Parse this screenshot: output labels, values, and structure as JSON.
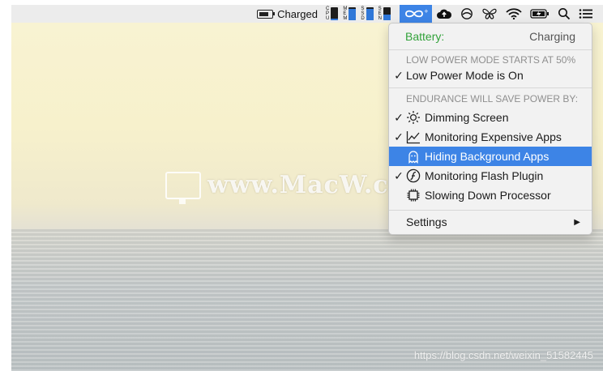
{
  "menubar": {
    "battery_text": "Charged",
    "stats": [
      {
        "letters": [
          "C",
          "P",
          "U"
        ],
        "fill": 0.15
      },
      {
        "letters": [
          "M",
          "E",
          "M"
        ],
        "fill": 0.85
      },
      {
        "letters": [
          "S",
          "S",
          "D"
        ],
        "fill": 0.9
      },
      {
        "letters": [
          "S",
          "E",
          "N"
        ],
        "fill": 0.45
      }
    ],
    "icons": [
      "endurance-icon",
      "cloud-upload-icon",
      "circle-slash-icon",
      "butterfly-icon",
      "wifi-icon",
      "battery-charging-icon",
      "search-icon",
      "list-icon"
    ]
  },
  "dropdown": {
    "battery_label": "Battery:",
    "battery_value": "Charging",
    "low_power_header": "LOW POWER MODE STARTS AT 50%",
    "low_power_item": "Low Power Mode is On",
    "endurance_header": "ENDURANCE WILL SAVE POWER BY:",
    "items": [
      {
        "label": "Dimming Screen",
        "checked": true,
        "icon": "sun-icon"
      },
      {
        "label": "Monitoring Expensive Apps",
        "checked": true,
        "icon": "chart-line-icon"
      },
      {
        "label": "Hiding Background Apps",
        "checked": false,
        "icon": "ghost-icon",
        "highlighted": true
      },
      {
        "label": "Monitoring Flash Plugin",
        "checked": true,
        "icon": "flash-plugin-icon"
      },
      {
        "label": "Slowing Down Processor",
        "checked": false,
        "icon": "processor-icon"
      }
    ],
    "settings_label": "Settings",
    "check_glyph": "✓",
    "submenu_glyph": "▶"
  },
  "watermark": {
    "text": "www.MacW.com"
  },
  "credit": {
    "text": "https://blog.csdn.net/weixin_51582445"
  },
  "colors": {
    "accent": "#3d84e6",
    "battery_green": "#32a23a"
  }
}
